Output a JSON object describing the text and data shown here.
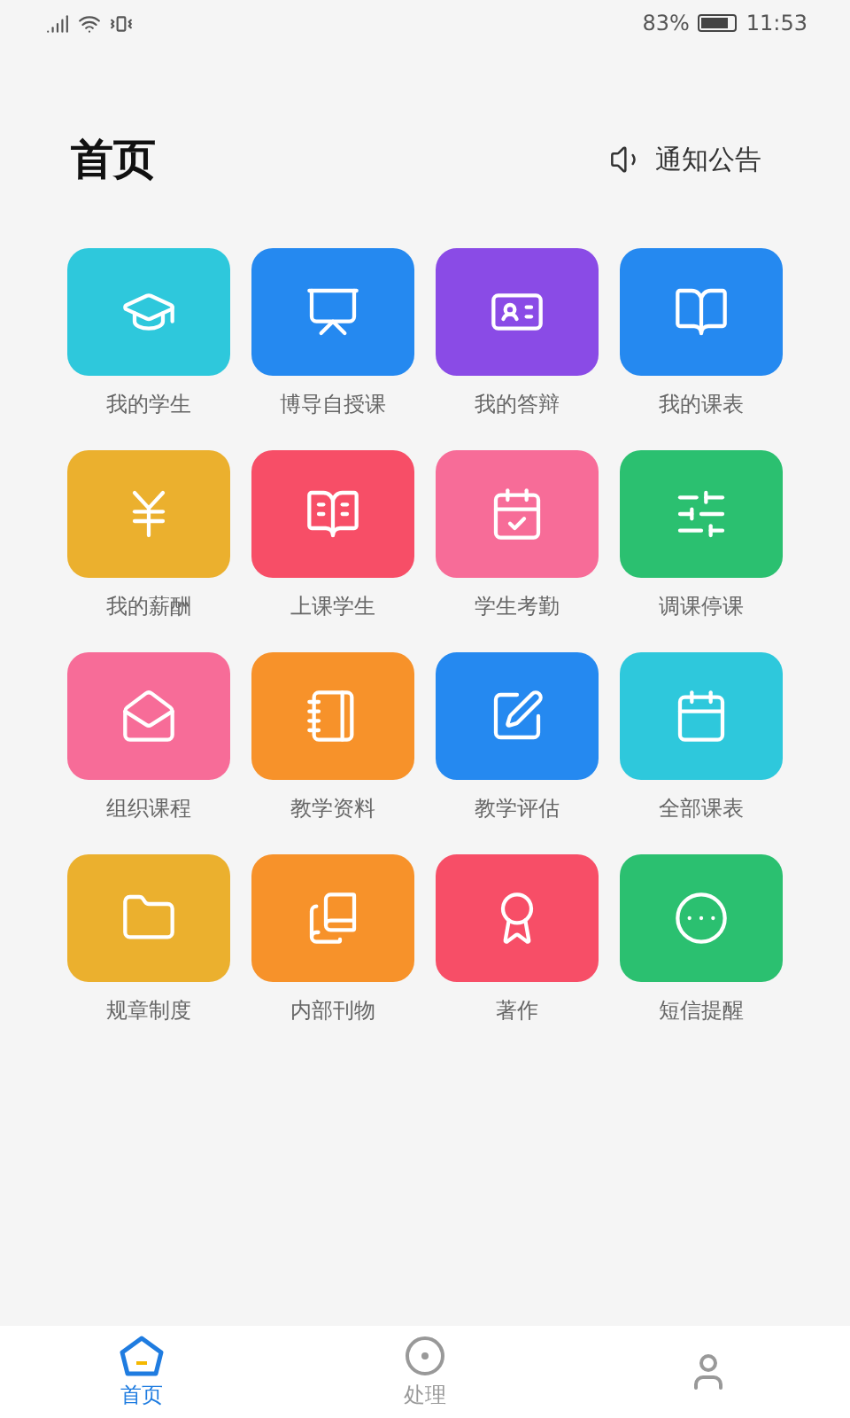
{
  "status_bar": {
    "battery": "83%",
    "time": "11:53"
  },
  "header": {
    "title": "首页",
    "notice": "通知公告"
  },
  "tiles": [
    {
      "label": "我的学生",
      "color": "#2ec8dc"
    },
    {
      "label": "博导自授课",
      "color": "#2589f0"
    },
    {
      "label": "我的答辩",
      "color": "#8a4be6"
    },
    {
      "label": "我的课表",
      "color": "#2589f0"
    },
    {
      "label": "我的薪酬",
      "color": "#ebb02e"
    },
    {
      "label": "上课学生",
      "color": "#f74e67"
    },
    {
      "label": "学生考勤",
      "color": "#f76c98"
    },
    {
      "label": "调课停课",
      "color": "#2bc070"
    },
    {
      "label": "组织课程",
      "color": "#f76c98"
    },
    {
      "label": "教学资料",
      "color": "#f7922a"
    },
    {
      "label": "教学评估",
      "color": "#2589f0"
    },
    {
      "label": "全部课表",
      "color": "#2ec8dc"
    },
    {
      "label": "规章制度",
      "color": "#ebb02e"
    },
    {
      "label": "内部刊物",
      "color": "#f7922a"
    },
    {
      "label": "著作",
      "color": "#f74e67"
    },
    {
      "label": "短信提醒",
      "color": "#2bc070"
    }
  ],
  "tabs": [
    {
      "label": "首页",
      "selected": true
    },
    {
      "label": "处理",
      "selected": false
    },
    {
      "selected": false
    }
  ]
}
